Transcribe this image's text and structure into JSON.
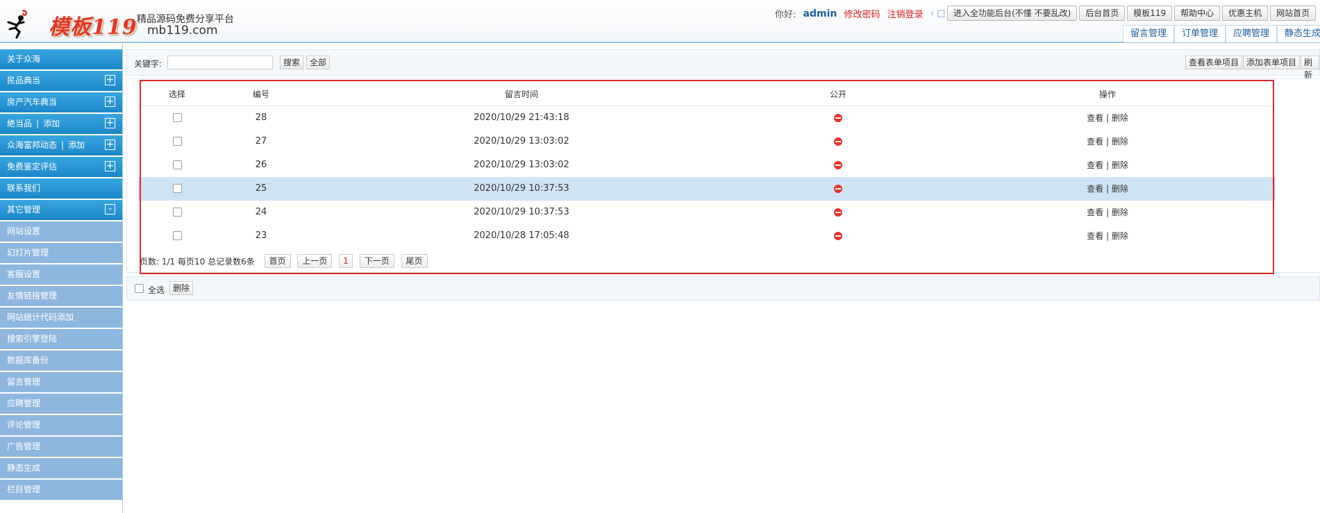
{
  "header": {
    "logo_text": "模板119",
    "slogan": "精品源码免费分享平台",
    "domain": "mb119.com",
    "greeting": "你好:",
    "username": "admin",
    "change_password": "修改密码",
    "logout": "注销登录",
    "nav_arrows": "‹ □ ›",
    "buttons": [
      "进入全功能后台(不懂 不要乱改)",
      "后台首页",
      "模板119",
      "帮助中心",
      "优惠主机",
      "网站首页"
    ],
    "tabs": [
      "留言管理",
      "订单管理",
      "应聘管理",
      "静态生成"
    ]
  },
  "sidebar": {
    "heads": [
      {
        "label": "关于众海",
        "plus": false
      },
      {
        "label": "民品典当",
        "plus": true
      },
      {
        "label": "房产汽车典当",
        "plus": true
      },
      {
        "label": "绝当品",
        "add": "添加",
        "plus": true
      },
      {
        "label": "众海富邦动态",
        "add": "添加",
        "plus": true
      },
      {
        "label": "免费鉴定评估",
        "plus": true
      },
      {
        "label": "联系我们",
        "plus": false
      },
      {
        "label": "其它管理",
        "minus": true
      }
    ],
    "plus_symbol": "+",
    "minus_symbol": "-",
    "separator": "|",
    "sub_items": [
      "网站设置",
      "幻灯片管理",
      "客服设置",
      "友情链接管理",
      "网站统计代码添加",
      "搜索引擎登陆",
      "数据库备份",
      "留言管理",
      "应聘管理",
      "评论管理",
      "广告管理",
      "静态生成",
      "栏目管理"
    ]
  },
  "search": {
    "label": "关键字:",
    "input_value": "",
    "search_button": "搜索",
    "all_button": "全部",
    "right_buttons": [
      "查看表单项目",
      "添加表单项目",
      "刷新"
    ]
  },
  "table": {
    "headers": [
      "选择",
      "编号",
      "留言时间",
      "公开",
      "操作"
    ],
    "rows": [
      {
        "id": "28",
        "time": "2020/10/29 21:43:18",
        "highlight": false
      },
      {
        "id": "27",
        "time": "2020/10/29 13:03:02",
        "highlight": false
      },
      {
        "id": "26",
        "time": "2020/10/29 13:03:02",
        "highlight": false
      },
      {
        "id": "25",
        "time": "2020/10/29 10:37:53",
        "highlight": true
      },
      {
        "id": "24",
        "time": "2020/10/29 10:37:53",
        "highlight": false
      },
      {
        "id": "23",
        "time": "2020/10/28 17:05:48",
        "highlight": false
      }
    ],
    "view_label": "查看",
    "separator": "|",
    "delete_label": "删除"
  },
  "pager": {
    "info": "页数: 1/1 每页10 总记录数6条",
    "buttons": [
      "首页",
      "上一页",
      "1",
      "下一页",
      "尾页"
    ],
    "current": "1"
  },
  "bottom": {
    "select_all": "全选",
    "delete": "删除"
  },
  "colors": {
    "sidebar_head": "#1c87c9",
    "sidebar_sub": "#8eb7df",
    "highlight_row": "#cfe3f5",
    "frame_red": "#e02828"
  }
}
